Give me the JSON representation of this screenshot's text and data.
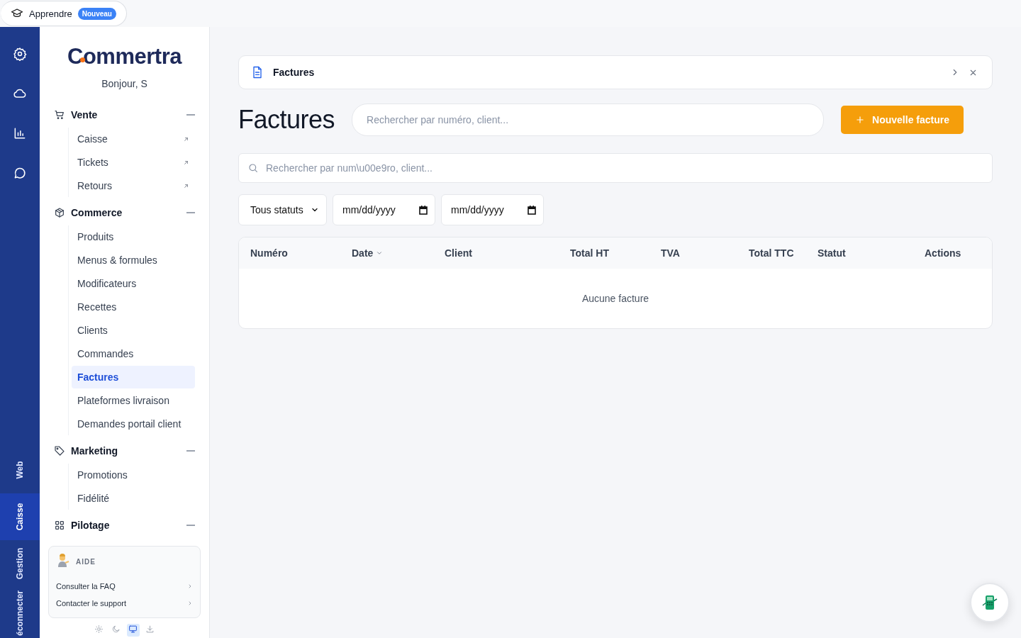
{
  "learn_pill": {
    "label": "Apprendre",
    "badge": "Nouveau"
  },
  "rail": {
    "icons": [
      {
        "kind": "settings"
      },
      {
        "kind": "cloud"
      },
      {
        "kind": "chart"
      },
      {
        "kind": "chat"
      }
    ],
    "tabs": [
      {
        "label": "Web",
        "selected": false
      },
      {
        "label": "Caisse",
        "selected": true
      },
      {
        "label": "Gestion",
        "selected": false
      },
      {
        "label": "éconnecter",
        "selected": false
      }
    ]
  },
  "sidebar": {
    "logo": "Commertra",
    "greeting": "Bonjour, S",
    "groups": [
      {
        "label": "Vente",
        "kind": "cart",
        "expanded": true,
        "items": [
          {
            "label": "Caisse",
            "selected": false,
            "external": true
          },
          {
            "label": "Tickets",
            "selected": false,
            "external": true
          },
          {
            "label": "Retours",
            "selected": false,
            "external": true
          }
        ]
      },
      {
        "label": "Commerce",
        "kind": "box",
        "expanded": true,
        "items": [
          {
            "label": "Produits",
            "selected": false,
            "external": false
          },
          {
            "label": "Menus & formules",
            "selected": false,
            "external": false
          },
          {
            "label": "Modificateurs",
            "selected": false,
            "external": false
          },
          {
            "label": "Recettes",
            "selected": false,
            "external": false
          },
          {
            "label": "Clients",
            "selected": false,
            "external": false
          },
          {
            "label": "Commandes",
            "selected": false,
            "external": false
          },
          {
            "label": "Factures",
            "selected": true,
            "external": false
          },
          {
            "label": "Plateformes livraison",
            "selected": false,
            "external": false
          },
          {
            "label": "Demandes portail client",
            "selected": false,
            "external": false
          }
        ]
      },
      {
        "label": "Marketing",
        "kind": "tag",
        "expanded": true,
        "items": [
          {
            "label": "Promotions",
            "selected": false,
            "external": false
          },
          {
            "label": "Fidélité",
            "selected": false,
            "external": false
          }
        ]
      },
      {
        "label": "Pilotage",
        "kind": "grid",
        "expanded": true
      }
    ],
    "help": {
      "title": "AIDE",
      "links": [
        "Consulter la FAQ",
        "Contacter le support"
      ]
    },
    "themes": [
      {
        "kind": "light",
        "selected": false
      },
      {
        "kind": "dark",
        "selected": false
      },
      {
        "kind": "system",
        "selected": true
      },
      {
        "kind": "install",
        "selected": false
      }
    ]
  },
  "breadcrumb": {
    "label": "Factures"
  },
  "header": {
    "title": "Factures",
    "search": {
      "placeholder": "Rechercher par numéro, client..."
    },
    "button": "Nouvelle facture"
  },
  "search": {
    "placeholder": "Rechercher par num\\u00e9ro, client..."
  },
  "filters": {
    "status": "Tous statuts",
    "date_from": "mm/dd/yyyy",
    "date_to": "mm/dd/yyyy"
  },
  "table": {
    "columns": [
      {
        "label": "Numéro",
        "sorted": false
      },
      {
        "label": "Date",
        "sorted": true
      },
      {
        "label": "Client",
        "sorted": false
      },
      {
        "label": "Total HT",
        "sorted": false
      },
      {
        "label": "TVA",
        "sorted": false
      },
      {
        "label": "Total TTC",
        "sorted": false
      },
      {
        "label": "Statut",
        "sorted": false
      },
      {
        "label": "Actions",
        "sorted": false
      }
    ],
    "empty": "Aucune facture"
  }
}
